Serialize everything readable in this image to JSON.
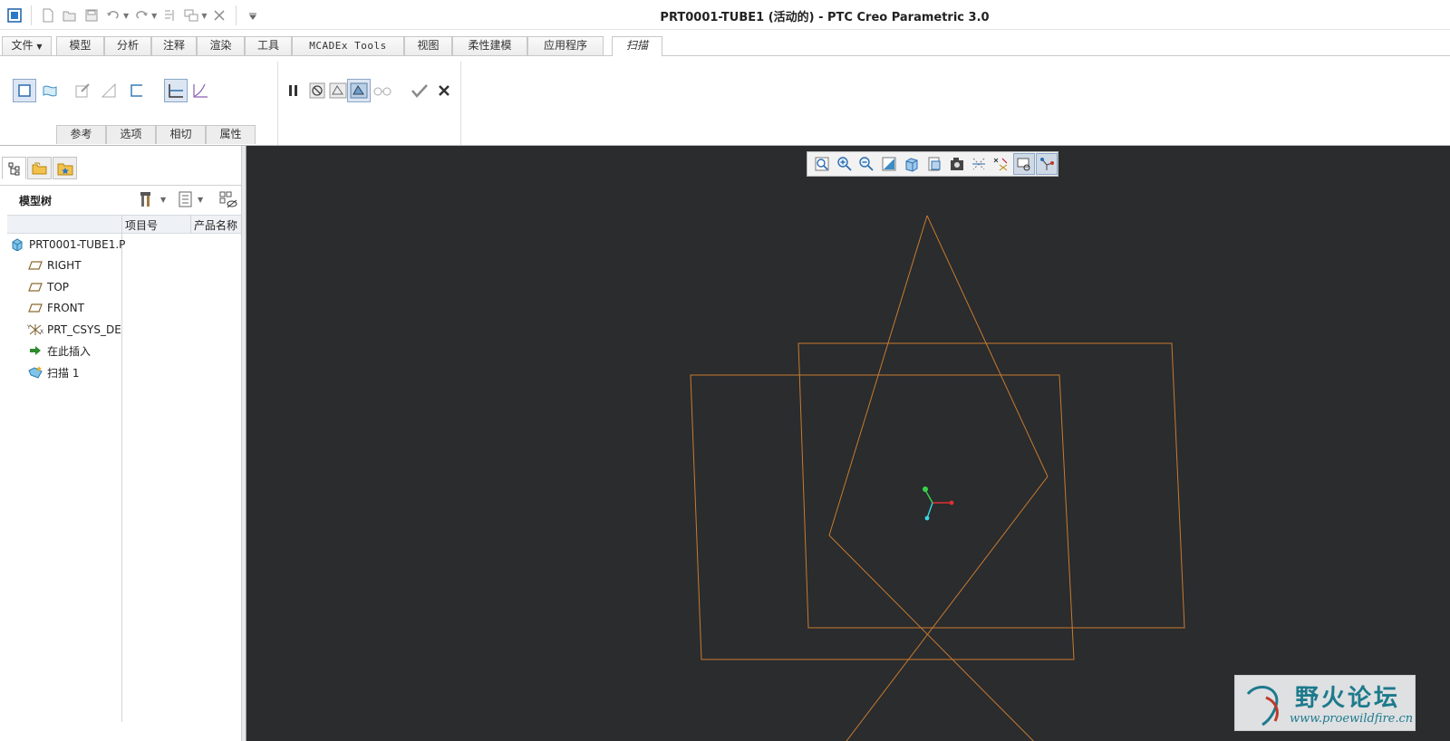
{
  "window": {
    "title": "PRT0001-TUBE1 (活动的) - PTC Creo Parametric 3.0"
  },
  "quick_access": {
    "icons": [
      "app-icon",
      "new-icon",
      "open-icon",
      "save-icon",
      "undo-icon",
      "redo-icon",
      "regenerate-icon",
      "windows-icon",
      "close-window-icon",
      "customize-icon"
    ]
  },
  "ribbon": {
    "file_tab": "文件",
    "tabs": [
      "模型",
      "分析",
      "注释",
      "渲染",
      "工具",
      "MCADEx Tools",
      "视图",
      "柔性建模",
      "应用程序"
    ],
    "active_tab": "扫描",
    "subtabs": [
      "参考",
      "选项",
      "相切",
      "属性"
    ]
  },
  "model_tree": {
    "title": "模型树",
    "columns": [
      "项目号",
      "产品名称"
    ],
    "items": [
      {
        "label": "PRT0001-TUBE1.P",
        "icon": "part-icon"
      },
      {
        "label": "RIGHT",
        "icon": "datum-plane-icon"
      },
      {
        "label": "TOP",
        "icon": "datum-plane-icon"
      },
      {
        "label": "FRONT",
        "icon": "datum-plane-icon"
      },
      {
        "label": "PRT_CSYS_DEF",
        "icon": "csys-icon"
      },
      {
        "label": "在此插入",
        "icon": "insert-here-icon"
      },
      {
        "label": "扫描 1",
        "icon": "sweep-icon"
      }
    ]
  },
  "graphics": {
    "background": "#2a2c2e",
    "sketch_color": "#c97a2e"
  },
  "watermark": {
    "name": "野火论坛",
    "url": "www.proewildfire.cn"
  }
}
